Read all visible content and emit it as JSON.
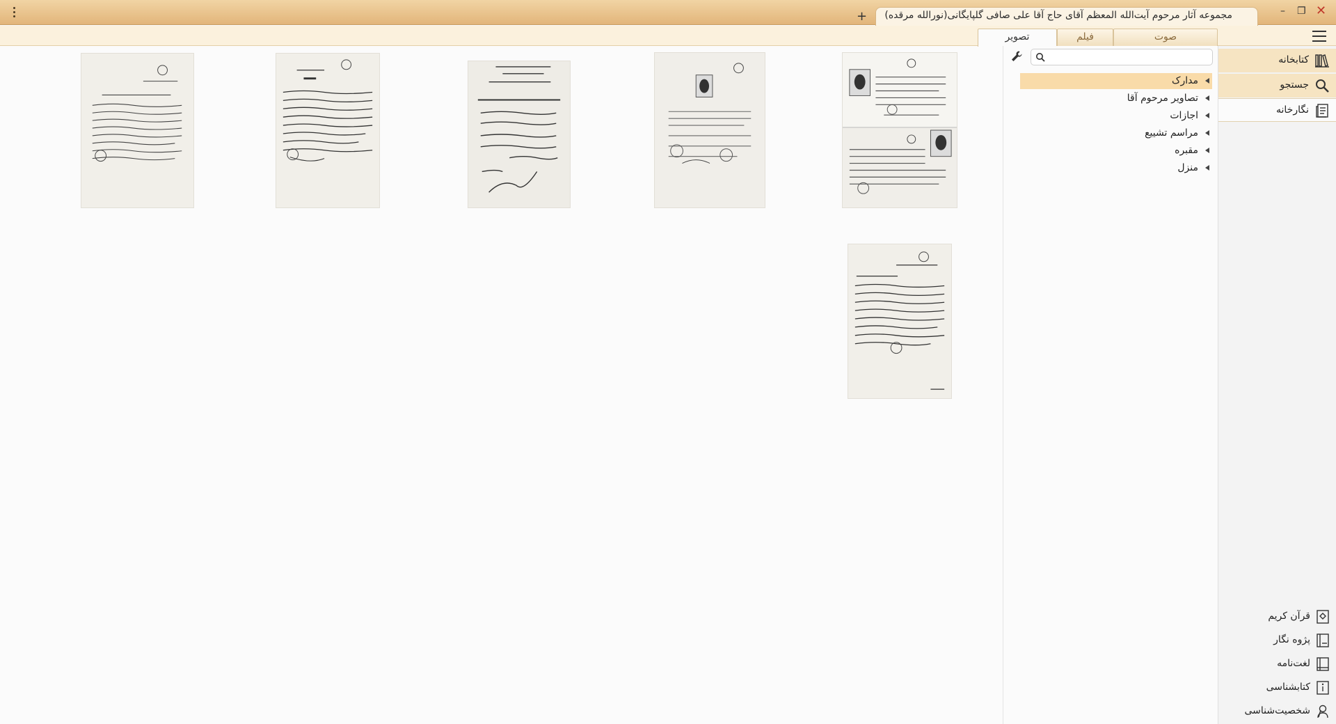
{
  "window": {
    "title": "مجموعه آثار مرحوم آیت‌الله المعظم آقای حاج آقا علی صافی گلپایگانی(نورالله مرقده)",
    "new_tab_glyph": "+",
    "menu_icon": "kebab-menu-icon",
    "controls": {
      "minimize": "–",
      "restore": "❐",
      "close": "✕"
    }
  },
  "media_tabs": [
    {
      "label": "صوت",
      "active": false
    },
    {
      "label": "فیلم",
      "active": false
    },
    {
      "label": "تصویر",
      "active": true
    }
  ],
  "nav": {
    "top": [
      {
        "label": "کتابخانه",
        "icon": "library-icon",
        "state": "highlighted"
      },
      {
        "label": "جستجو",
        "icon": "search-icon",
        "state": "highlighted"
      },
      {
        "label": "نگارخانه",
        "icon": "gallery-icon",
        "state": "selected"
      }
    ],
    "bottom": [
      {
        "label": "قرآن کریم",
        "icon": "quran-icon"
      },
      {
        "label": "پژوه نگار",
        "icon": "notes-icon"
      },
      {
        "label": "لغت‌نامه",
        "icon": "dictionary-icon"
      },
      {
        "label": "کتابشناسی",
        "icon": "info-book-icon"
      },
      {
        "label": "شخصیت‌شناسی",
        "icon": "person-icon"
      }
    ]
  },
  "search": {
    "value": "",
    "placeholder": ""
  },
  "tree": [
    {
      "label": "مدارک",
      "selected": true
    },
    {
      "label": "تصاویر مرحوم آقا",
      "selected": false
    },
    {
      "label": "اجازات",
      "selected": false
    },
    {
      "label": "مراسم تشییع",
      "selected": false
    },
    {
      "label": "مقبره",
      "selected": false
    },
    {
      "label": "منزل",
      "selected": false
    }
  ],
  "thumbnails": [
    {
      "kind": "certificate-with-photos"
    },
    {
      "kind": "certificate-with-photo"
    },
    {
      "kind": "handwritten-letter"
    },
    {
      "kind": "handwritten-letter"
    },
    {
      "kind": "handwritten-letter"
    },
    {
      "kind": "handwritten-letter"
    }
  ]
}
